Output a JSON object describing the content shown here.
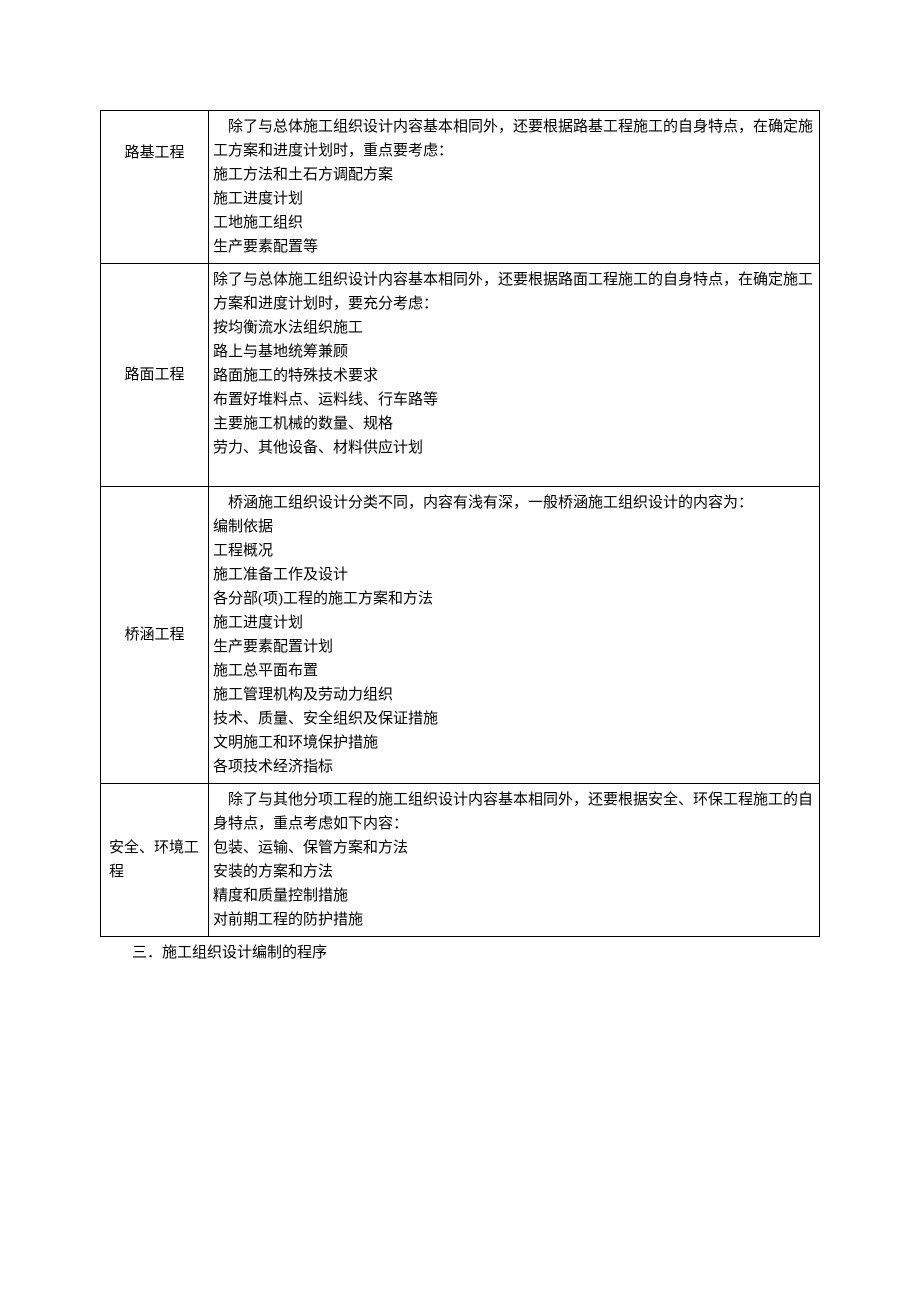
{
  "table": {
    "rows": [
      {
        "label": "路基工程",
        "labelWrap": false,
        "labelAlign": "upper",
        "lines": [
          {
            "text": "除了与总体施工组织设计内容基本相同外，还要根据路基工程施工的自身特点，在确定施工方案和进度计划时，重点要考虑：",
            "indent": true
          },
          {
            "text": "施工方法和土石方调配方案"
          },
          {
            "text": "施工进度计划"
          },
          {
            "text": "工地施工组织"
          },
          {
            "text": "生产要素配置等"
          }
        ]
      },
      {
        "label": "路面工程",
        "labelWrap": false,
        "labelAlign": "middle",
        "lines": [
          {
            "text": "除了与总体施工组织设计内容基本相同外，还要根据路面工程施工的自身特点，在确定施工方案和进度计划时，要充分考虑："
          },
          {
            "text": "按均衡流水法组织施工"
          },
          {
            "text": "路上与基地统筹兼顾"
          },
          {
            "text": "路面施工的特殊技术要求"
          },
          {
            "text": "布置好堆料点、运料线、行车路等"
          },
          {
            "text": "主要施工机械的数量、规格"
          },
          {
            "text": "劳力、其他设备、材料供应计划"
          },
          {
            "text": " ",
            "spacer": true
          }
        ]
      },
      {
        "label": "桥涵工程",
        "labelWrap": false,
        "labelAlign": "middle",
        "lines": [
          {
            "text": "桥涵施工组织设计分类不同，内容有浅有深，一般桥涵施工组织设计的内容为：",
            "indent": true
          },
          {
            "text": "编制依据"
          },
          {
            "text": "工程概况"
          },
          {
            "text": "施工准备工作及设计"
          },
          {
            "text": "各分部(项)工程的施工方案和方法"
          },
          {
            "text": "施工进度计划"
          },
          {
            "text": "生产要素配置计划"
          },
          {
            "text": "施工总平面布置"
          },
          {
            "text": "施工管理机构及劳动力组织"
          },
          {
            "text": "技术、质量、安全组织及保证措施"
          },
          {
            "text": "文明施工和环境保护措施"
          },
          {
            "text": "各项技术经济指标"
          }
        ]
      },
      {
        "label": "安全、环境工程",
        "labelWrap": true,
        "labelAlign": "middle",
        "lines": [
          {
            "text": "除了与其他分项工程的施工组织设计内容基本相同外，还要根据安全、环保工程施工的自身特点，重点考虑如下内容：",
            "indent": true
          },
          {
            "text": "包装、运输、保管方案和方法"
          },
          {
            "text": "安装的方案和方法"
          },
          {
            "text": "精度和质量控制措施"
          },
          {
            "text": "对前期工程的防护措施"
          }
        ]
      }
    ]
  },
  "footer": "三．施工组织设计编制的程序"
}
